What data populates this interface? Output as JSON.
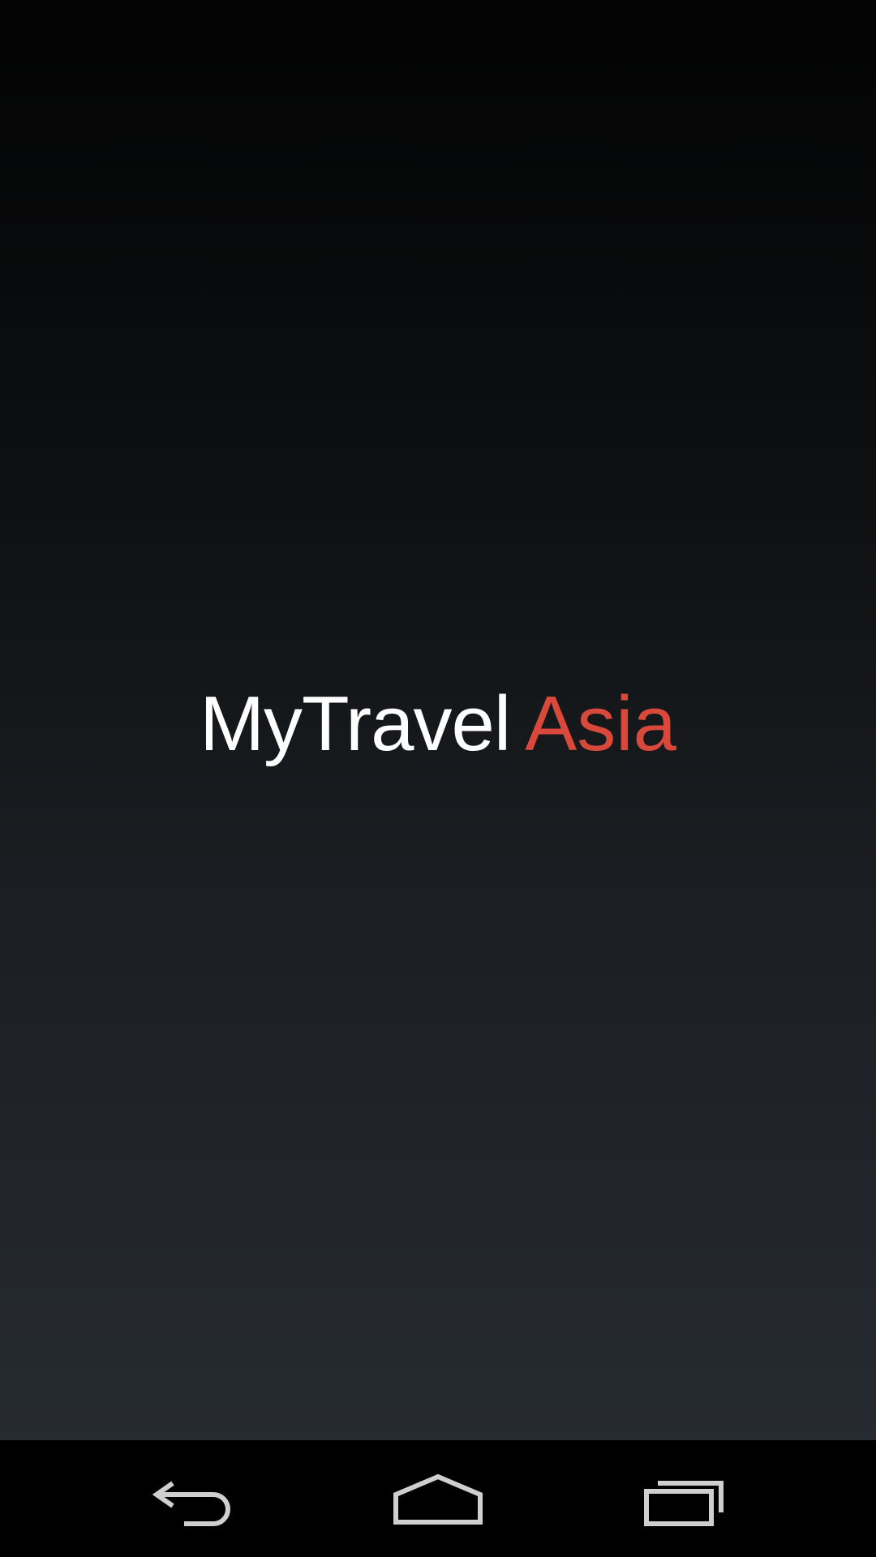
{
  "splash": {
    "title_part_1": "MyTravel",
    "title_part_2": "Asia"
  },
  "colors": {
    "title_primary": "#ffffff",
    "title_accent": "#d9493b",
    "background_top": "#030303",
    "background_bottom": "#262a31",
    "navbar": "#000000",
    "nav_icon": "#cfcfcf"
  },
  "navbar": {
    "buttons": [
      {
        "icon": "back-icon"
      },
      {
        "icon": "home-icon"
      },
      {
        "icon": "recent-apps-icon"
      }
    ]
  }
}
